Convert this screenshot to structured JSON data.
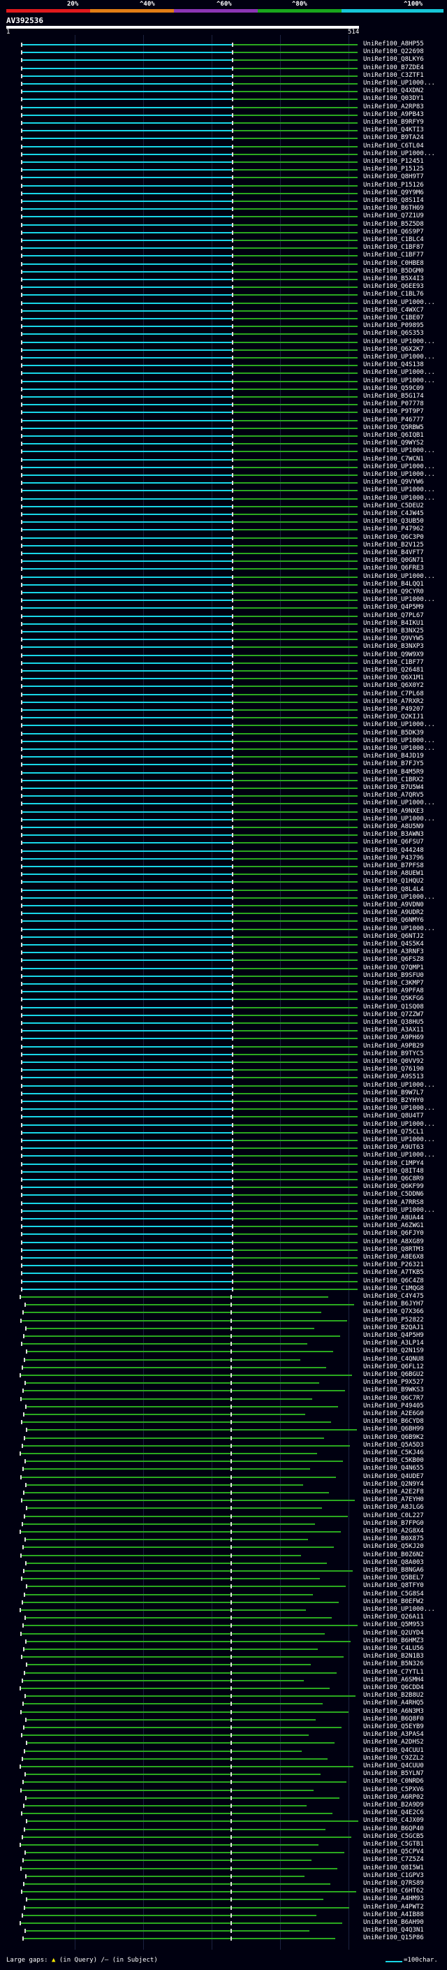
{
  "scale_header": {
    "labels": [
      "20%",
      "^40%",
      "^60%",
      "^80%",
      "^100%"
    ],
    "colors": [
      "#e0191c",
      "#e07c16",
      "#8b35b5",
      "#19a51c",
      "#17c6d8"
    ]
  },
  "query": {
    "name": "AV392536",
    "ruler_start": "1",
    "ruler_end": "514"
  },
  "hits": [
    {
      "label": "UniRef100_A8HP55",
      "coverage_class": "cyan"
    },
    {
      "label": "UniRef100_Q22698",
      "coverage_class": "cyan"
    },
    {
      "label": "UniRef100_Q8LKY6",
      "coverage_class": "cyan"
    },
    {
      "label": "UniRef100_B7ZDE4",
      "coverage_class": "cyan"
    },
    {
      "label": "UniRef100_C3ZTF1",
      "coverage_class": "cyan"
    },
    {
      "label": "UniRef100_UP1000...",
      "coverage_class": "cyan"
    },
    {
      "label": "UniRef100_Q4XDN2",
      "coverage_class": "cyan"
    },
    {
      "label": "UniRef100_Q03DY1",
      "coverage_class": "cyan"
    },
    {
      "label": "UniRef100_A2RP83",
      "coverage_class": "cyan"
    },
    {
      "label": "UniRef100_A9PB43",
      "coverage_class": "cyan"
    },
    {
      "label": "UniRef100_B9RFY9",
      "coverage_class": "cyan"
    },
    {
      "label": "UniRef100_Q4KTI3",
      "coverage_class": "cyan"
    },
    {
      "label": "UniRef100_B9TA24",
      "coverage_class": "cyan"
    },
    {
      "label": "UniRef100_C6TL04",
      "coverage_class": "cyan"
    },
    {
      "label": "UniRef100_UP1000...",
      "coverage_class": "cyan"
    },
    {
      "label": "UniRef100_P12451",
      "coverage_class": "cyan"
    },
    {
      "label": "UniRef100_P15125",
      "coverage_class": "cyan"
    },
    {
      "label": "UniRef100_Q8H9T7",
      "coverage_class": "cyan"
    },
    {
      "label": "UniRef100_P15126",
      "coverage_class": "cyan"
    },
    {
      "label": "UniRef100_Q9Y9M6",
      "coverage_class": "cyan"
    },
    {
      "label": "UniRef100_Q8S1I4",
      "coverage_class": "cyan"
    },
    {
      "label": "UniRef100_B6TH69",
      "coverage_class": "cyan"
    },
    {
      "label": "UniRef100_Q7Z1U9",
      "coverage_class": "cyan"
    },
    {
      "label": "UniRef100_B5Z5D8",
      "coverage_class": "cyan"
    },
    {
      "label": "UniRef100_Q6S9P7",
      "coverage_class": "cyan"
    },
    {
      "label": "UniRef100_C1BLC4",
      "coverage_class": "cyan"
    },
    {
      "label": "UniRef100_C1BF87",
      "coverage_class": "cyan"
    },
    {
      "label": "UniRef100_C1BF77",
      "coverage_class": "cyan"
    },
    {
      "label": "UniRef100_C0HBE8",
      "coverage_class": "cyan"
    },
    {
      "label": "UniRef100_B5DGM0",
      "coverage_class": "cyan"
    },
    {
      "label": "UniRef100_B5X4I3",
      "coverage_class": "cyan"
    },
    {
      "label": "UniRef100_Q6EE93",
      "coverage_class": "cyan"
    },
    {
      "label": "UniRef100_C1BL76",
      "coverage_class": "cyan"
    },
    {
      "label": "UniRef100_UP1000...",
      "coverage_class": "cyan"
    },
    {
      "label": "UniRef100_C4WXC7",
      "coverage_class": "cyan"
    },
    {
      "label": "UniRef100_C1BE07",
      "coverage_class": "cyan"
    },
    {
      "label": "UniRef100_P09895",
      "coverage_class": "cyan"
    },
    {
      "label": "UniRef100_Q6S353",
      "coverage_class": "cyan"
    },
    {
      "label": "UniRef100_UP1000...",
      "coverage_class": "cyan"
    },
    {
      "label": "UniRef100_Q6X2K7",
      "coverage_class": "cyan"
    },
    {
      "label": "UniRef100_UP1000...",
      "coverage_class": "cyan"
    },
    {
      "label": "UniRef100_Q4S138",
      "coverage_class": "cyan"
    },
    {
      "label": "UniRef100_UP1000...",
      "coverage_class": "cyan"
    },
    {
      "label": "UniRef100_UP1000...",
      "coverage_class": "cyan"
    },
    {
      "label": "UniRef100_Q59C09",
      "coverage_class": "cyan"
    },
    {
      "label": "UniRef100_B5G174",
      "coverage_class": "cyan"
    },
    {
      "label": "UniRef100_P07778",
      "coverage_class": "cyan"
    },
    {
      "label": "UniRef100_P9T9P7",
      "coverage_class": "cyan"
    },
    {
      "label": "UniRef100_P46777",
      "coverage_class": "cyan"
    },
    {
      "label": "UniRef100_Q5RBW5",
      "coverage_class": "cyan"
    },
    {
      "label": "UniRef100_Q6IQB1",
      "coverage_class": "cyan"
    },
    {
      "label": "UniRef100_Q9WYS2",
      "coverage_class": "cyan"
    },
    {
      "label": "UniRef100_UP1000...",
      "coverage_class": "cyan"
    },
    {
      "label": "UniRef100_C7WCN1",
      "coverage_class": "cyan"
    },
    {
      "label": "UniRef100_UP1000...",
      "coverage_class": "cyan"
    },
    {
      "label": "UniRef100_UP1000...",
      "coverage_class": "cyan"
    },
    {
      "label": "UniRef100_Q9VYW6",
      "coverage_class": "cyan"
    },
    {
      "label": "UniRef100_UP1000...",
      "coverage_class": "cyan"
    },
    {
      "label": "UniRef100_UP1000...",
      "coverage_class": "cyan"
    },
    {
      "label": "UniRef100_C5DEU2",
      "coverage_class": "cyan"
    },
    {
      "label": "UniRef100_C4JW45",
      "coverage_class": "cyan"
    },
    {
      "label": "UniRef100_Q3UB50",
      "coverage_class": "cyan"
    },
    {
      "label": "UniRef100_P47962",
      "coverage_class": "cyan"
    },
    {
      "label": "UniRef100_Q6C3P0",
      "coverage_class": "cyan"
    },
    {
      "label": "UniRef100_B2V125",
      "coverage_class": "cyan"
    },
    {
      "label": "UniRef100_B4VFT7",
      "coverage_class": "cyan"
    },
    {
      "label": "UniRef100_Q0GN71",
      "coverage_class": "cyan"
    },
    {
      "label": "UniRef100_Q6FRE3",
      "coverage_class": "cyan"
    },
    {
      "label": "UniRef100_UP1000...",
      "coverage_class": "cyan"
    },
    {
      "label": "UniRef100_B4LQQ1",
      "coverage_class": "cyan"
    },
    {
      "label": "UniRef100_Q9CYR0",
      "coverage_class": "cyan"
    },
    {
      "label": "UniRef100_UP1000...",
      "coverage_class": "cyan"
    },
    {
      "label": "UniRef100_Q4P5M9",
      "coverage_class": "cyan"
    },
    {
      "label": "UniRef100_Q7PL67",
      "coverage_class": "cyan"
    },
    {
      "label": "UniRef100_B4IKU1",
      "coverage_class": "cyan"
    },
    {
      "label": "UniRef100_B3NX25",
      "coverage_class": "cyan"
    },
    {
      "label": "UniRef100_Q9VYW5",
      "coverage_class": "cyan"
    },
    {
      "label": "UniRef100_B3NXP3",
      "coverage_class": "cyan"
    },
    {
      "label": "UniRef100_Q9W9X9",
      "coverage_class": "cyan"
    },
    {
      "label": "UniRef100_C1BF77",
      "coverage_class": "cyan"
    },
    {
      "label": "UniRef100_Q26481",
      "coverage_class": "cyan"
    },
    {
      "label": "UniRef100_Q6X1M1",
      "coverage_class": "cyan"
    },
    {
      "label": "UniRef100_Q6X0Y2",
      "coverage_class": "cyan"
    },
    {
      "label": "UniRef100_C7PL68",
      "coverage_class": "cyan"
    },
    {
      "label": "UniRef100_A7RXR2",
      "coverage_class": "cyan"
    },
    {
      "label": "UniRef100_P49207",
      "coverage_class": "cyan"
    },
    {
      "label": "UniRef100_Q2KIJ1",
      "coverage_class": "cyan"
    },
    {
      "label": "UniRef100_UP1000...",
      "coverage_class": "cyan"
    },
    {
      "label": "UniRef100_B5DK39",
      "coverage_class": "cyan"
    },
    {
      "label": "UniRef100_UP1000...",
      "coverage_class": "cyan"
    },
    {
      "label": "UniRef100_UP1000...",
      "coverage_class": "cyan"
    },
    {
      "label": "UniRef100_B4JD19",
      "coverage_class": "cyan"
    },
    {
      "label": "UniRef100_B7FJY5",
      "coverage_class": "cyan"
    },
    {
      "label": "UniRef100_B4M5R9",
      "coverage_class": "cyan"
    },
    {
      "label": "UniRef100_C1BRX2",
      "coverage_class": "cyan"
    },
    {
      "label": "UniRef100_B7U5W4",
      "coverage_class": "cyan"
    },
    {
      "label": "UniRef100_A7QRV5",
      "coverage_class": "cyan"
    },
    {
      "label": "UniRef100_UP1000...",
      "coverage_class": "cyan"
    },
    {
      "label": "UniRef100_A9NXE3",
      "coverage_class": "cyan"
    },
    {
      "label": "UniRef100_UP1000...",
      "coverage_class": "cyan"
    },
    {
      "label": "UniRef100_A8U5N9",
      "coverage_class": "cyan"
    },
    {
      "label": "UniRef100_B3AWN3",
      "coverage_class": "cyan"
    },
    {
      "label": "UniRef100_Q6FSU7",
      "coverage_class": "cyan"
    },
    {
      "label": "UniRef100_Q44248",
      "coverage_class": "cyan"
    },
    {
      "label": "UniRef100_P43796",
      "coverage_class": "cyan"
    },
    {
      "label": "UniRef100_B7PFS8",
      "coverage_class": "cyan"
    },
    {
      "label": "UniRef100_A8UEW1",
      "coverage_class": "cyan"
    },
    {
      "label": "UniRef100_Q1HQU2",
      "coverage_class": "cyan"
    },
    {
      "label": "UniRef100_Q8L4L4",
      "coverage_class": "cyan"
    },
    {
      "label": "UniRef100_UP1000...",
      "coverage_class": "cyan"
    },
    {
      "label": "UniRef100_A9VDN0",
      "coverage_class": "cyan"
    },
    {
      "label": "UniRef100_A9UDR2",
      "coverage_class": "cyan"
    },
    {
      "label": "UniRef100_Q6NMY6",
      "coverage_class": "cyan"
    },
    {
      "label": "UniRef100_UP1000...",
      "coverage_class": "cyan"
    },
    {
      "label": "UniRef100_Q6NTJ2",
      "coverage_class": "cyan"
    },
    {
      "label": "UniRef100_Q4S5K4",
      "coverage_class": "cyan"
    },
    {
      "label": "UniRef100_A3RNF3",
      "coverage_class": "cyan"
    },
    {
      "label": "UniRef100_Q6FSZ8",
      "coverage_class": "cyan"
    },
    {
      "label": "UniRef100_Q7QMP1",
      "coverage_class": "cyan"
    },
    {
      "label": "UniRef100_B9SFU0",
      "coverage_class": "cyan"
    },
    {
      "label": "UniRef100_C3KMP7",
      "coverage_class": "cyan"
    },
    {
      "label": "UniRef100_A9PFA8",
      "coverage_class": "cyan"
    },
    {
      "label": "UniRef100_Q5KFG6",
      "coverage_class": "cyan"
    },
    {
      "label": "UniRef100_Q1SQ08",
      "coverage_class": "cyan"
    },
    {
      "label": "UniRef100_Q7ZZW7",
      "coverage_class": "cyan"
    },
    {
      "label": "UniRef100_Q38HU5",
      "coverage_class": "cyan"
    },
    {
      "label": "UniRef100_A3AX11",
      "coverage_class": "cyan"
    },
    {
      "label": "UniRef100_A9PH69",
      "coverage_class": "cyan"
    },
    {
      "label": "UniRef100_A9PB29",
      "coverage_class": "cyan"
    },
    {
      "label": "UniRef100_B9TYC5",
      "coverage_class": "cyan"
    },
    {
      "label": "UniRef100_Q0VV92",
      "coverage_class": "cyan"
    },
    {
      "label": "UniRef100_Q76190",
      "coverage_class": "cyan"
    },
    {
      "label": "UniRef100_A9S513",
      "coverage_class": "cyan"
    },
    {
      "label": "UniRef100_UP1000...",
      "coverage_class": "cyan"
    },
    {
      "label": "UniRef100_B9W7L7",
      "coverage_class": "cyan"
    },
    {
      "label": "UniRef100_B2YHY0",
      "coverage_class": "cyan"
    },
    {
      "label": "UniRef100_UP1000...",
      "coverage_class": "cyan"
    },
    {
      "label": "UniRef100_Q8U4T7",
      "coverage_class": "cyan"
    },
    {
      "label": "UniRef100_UP1000...",
      "coverage_class": "cyan"
    },
    {
      "label": "UniRef100_Q75CL1",
      "coverage_class": "cyan"
    },
    {
      "label": "UniRef100_UP1000...",
      "coverage_class": "cyan"
    },
    {
      "label": "UniRef100_A9UT63",
      "coverage_class": "cyan"
    },
    {
      "label": "UniRef100_UP1000...",
      "coverage_class": "cyan"
    },
    {
      "label": "UniRef100_C1MPY4",
      "coverage_class": "cyan"
    },
    {
      "label": "UniRef100_Q8IT48",
      "coverage_class": "cyan"
    },
    {
      "label": "UniRef100_Q6C8R9",
      "coverage_class": "cyan"
    },
    {
      "label": "UniRef100_Q6KF99",
      "coverage_class": "cyan"
    },
    {
      "label": "UniRef100_C5DDN6",
      "coverage_class": "cyan"
    },
    {
      "label": "UniRef100_A7RRS8",
      "coverage_class": "cyan"
    },
    {
      "label": "UniRef100_UP1000...",
      "coverage_class": "cyan"
    },
    {
      "label": "UniRef100_A8UA44",
      "coverage_class": "cyan"
    },
    {
      "label": "UniRef100_A6ZWG1",
      "coverage_class": "cyan"
    },
    {
      "label": "UniRef100_Q6FJY0",
      "coverage_class": "cyan"
    },
    {
      "label": "UniRef100_A8XG89",
      "coverage_class": "cyan"
    },
    {
      "label": "UniRef100_Q8RTM3",
      "coverage_class": "cyan"
    },
    {
      "label": "UniRef100_A8E6X8",
      "coverage_class": "cyan"
    },
    {
      "label": "UniRef100_P26321",
      "coverage_class": "cyan"
    },
    {
      "label": "UniRef100_A7TKB5",
      "coverage_class": "cyan"
    },
    {
      "label": "UniRef100_Q6C4Z8",
      "coverage_class": "cyan"
    },
    {
      "label": "UniRef100_C1MQG8",
      "coverage_class": "cyan"
    },
    {
      "label": "UniRef100_C4Y475",
      "coverage_class": "green"
    },
    {
      "label": "UniRef100_B6JYH7",
      "coverage_class": "green"
    },
    {
      "label": "UniRef100_Q7X366",
      "coverage_class": "green"
    },
    {
      "label": "UniRef100_P52822",
      "coverage_class": "green"
    },
    {
      "label": "UniRef100_B2QAJ1",
      "coverage_class": "green"
    },
    {
      "label": "UniRef100_Q4P5H9",
      "coverage_class": "green"
    },
    {
      "label": "UniRef100_A3LP14",
      "coverage_class": "green"
    },
    {
      "label": "UniRef100_Q2N1S9",
      "coverage_class": "green"
    },
    {
      "label": "UniRef100_C4QNU8",
      "coverage_class": "green"
    },
    {
      "label": "UniRef100_Q6FL12",
      "coverage_class": "green"
    },
    {
      "label": "UniRef100_Q6BGU2",
      "coverage_class": "green"
    },
    {
      "label": "UniRef100_P9X527",
      "coverage_class": "green"
    },
    {
      "label": "UniRef100_B9WKS3",
      "coverage_class": "green"
    },
    {
      "label": "UniRef100_Q6C7R7",
      "coverage_class": "green"
    },
    {
      "label": "UniRef100_P49405",
      "coverage_class": "green"
    },
    {
      "label": "UniRef100_A2E6G0",
      "coverage_class": "green"
    },
    {
      "label": "UniRef100_B6CYD8",
      "coverage_class": "green"
    },
    {
      "label": "UniRef100_Q6BH99",
      "coverage_class": "green"
    },
    {
      "label": "UniRef100_Q6B9K2",
      "coverage_class": "green"
    },
    {
      "label": "UniRef100_Q5A5D3",
      "coverage_class": "green"
    },
    {
      "label": "UniRef100_C5KJ46",
      "coverage_class": "green"
    },
    {
      "label": "UniRef100_C5KB00",
      "coverage_class": "green"
    },
    {
      "label": "UniRef100_Q4N655",
      "coverage_class": "green"
    },
    {
      "label": "UniRef100_Q4UDE7",
      "coverage_class": "green"
    },
    {
      "label": "UniRef100_Q2N9Y4",
      "coverage_class": "green"
    },
    {
      "label": "UniRef100_A2E2F8",
      "coverage_class": "green"
    },
    {
      "label": "UniRef100_A7EYH0",
      "coverage_class": "green"
    },
    {
      "label": "UniRef100_A8JLG6",
      "coverage_class": "green"
    },
    {
      "label": "UniRef100_C0L227",
      "coverage_class": "green"
    },
    {
      "label": "UniRef100_B7FPG0",
      "coverage_class": "green"
    },
    {
      "label": "UniRef100_A2G8X4",
      "coverage_class": "green"
    },
    {
      "label": "UniRef100_B0X875",
      "coverage_class": "green"
    },
    {
      "label": "UniRef100_Q5KJ20",
      "coverage_class": "green"
    },
    {
      "label": "UniRef100_B0Z6N2",
      "coverage_class": "green"
    },
    {
      "label": "UniRef100_Q8A003",
      "coverage_class": "green"
    },
    {
      "label": "UniRef100_B8NGA6",
      "coverage_class": "green"
    },
    {
      "label": "UniRef100_Q5BEL7",
      "coverage_class": "green"
    },
    {
      "label": "UniRef100_Q8TFY0",
      "coverage_class": "green"
    },
    {
      "label": "UniRef100_C5G8S4",
      "coverage_class": "green"
    },
    {
      "label": "UniRef100_B0EFW2",
      "coverage_class": "green"
    },
    {
      "label": "UniRef100_UP1000...",
      "coverage_class": "green"
    },
    {
      "label": "UniRef100_Q26A11",
      "coverage_class": "green"
    },
    {
      "label": "UniRef100_Q5M953",
      "coverage_class": "green"
    },
    {
      "label": "UniRef100_Q2UYD4",
      "coverage_class": "green"
    },
    {
      "label": "UniRef100_B6HMZ3",
      "coverage_class": "green"
    },
    {
      "label": "UniRef100_C4LU56",
      "coverage_class": "green"
    },
    {
      "label": "UniRef100_B2N1B3",
      "coverage_class": "green"
    },
    {
      "label": "UniRef100_B5N326",
      "coverage_class": "green"
    },
    {
      "label": "UniRef100_C7YTL1",
      "coverage_class": "green"
    },
    {
      "label": "UniRef100_A6SMH4",
      "coverage_class": "green"
    },
    {
      "label": "UniRef100_Q6CDD4",
      "coverage_class": "green"
    },
    {
      "label": "UniRef100_B2B8U2",
      "coverage_class": "green"
    },
    {
      "label": "UniRef100_A4RHQ5",
      "coverage_class": "green"
    },
    {
      "label": "UniRef100_A6N3M3",
      "coverage_class": "green"
    },
    {
      "label": "UniRef100_B6Q8F0",
      "coverage_class": "green"
    },
    {
      "label": "UniRef100_Q5EYB9",
      "coverage_class": "green"
    },
    {
      "label": "UniRef100_A3PAS4",
      "coverage_class": "green"
    },
    {
      "label": "UniRef100_A2DHS2",
      "coverage_class": "green"
    },
    {
      "label": "UniRef100_Q4CUU1",
      "coverage_class": "green"
    },
    {
      "label": "UniRef100_C9ZZL2",
      "coverage_class": "green"
    },
    {
      "label": "UniRef100_Q4CUU0",
      "coverage_class": "green"
    },
    {
      "label": "UniRef100_B5YLN7",
      "coverage_class": "green"
    },
    {
      "label": "UniRef100_C0NRD6",
      "coverage_class": "green"
    },
    {
      "label": "UniRef100_C5PXV6",
      "coverage_class": "green"
    },
    {
      "label": "UniRef100_A6RP02",
      "coverage_class": "green"
    },
    {
      "label": "UniRef100_B2A9D9",
      "coverage_class": "green"
    },
    {
      "label": "UniRef100_Q4E2C6",
      "coverage_class": "green"
    },
    {
      "label": "UniRef100_C4JX09",
      "coverage_class": "green"
    },
    {
      "label": "UniRef100_B6QP40",
      "coverage_class": "green"
    },
    {
      "label": "UniRef100_C5GCB5",
      "coverage_class": "green"
    },
    {
      "label": "UniRef100_C5GTB1",
      "coverage_class": "green"
    },
    {
      "label": "UniRef100_Q5CPV4",
      "coverage_class": "green"
    },
    {
      "label": "UniRef100_C7Z5Z4",
      "coverage_class": "green"
    },
    {
      "label": "UniRef100_Q8I5W1",
      "coverage_class": "green"
    },
    {
      "label": "UniRef100_C1GPV3",
      "coverage_class": "green"
    },
    {
      "label": "UniRef100_Q7RS89",
      "coverage_class": "green"
    },
    {
      "label": "UniRef100_C6HT62",
      "coverage_class": "green"
    },
    {
      "label": "UniRef100_A4HM93",
      "coverage_class": "green"
    },
    {
      "label": "UniRef100_A4PWT2",
      "coverage_class": "green"
    },
    {
      "label": "UniRef100_A4IB88",
      "coverage_class": "green"
    },
    {
      "label": "UniRef100_B6AH90",
      "coverage_class": "green"
    },
    {
      "label": "UniRef100_Q4Q3N1",
      "coverage_class": "green"
    },
    {
      "label": "UniRef100_Q15P86",
      "coverage_class": "green"
    }
  ],
  "footer": {
    "gaps_label": "Large gaps:",
    "gap_query_mark": "▲",
    "gaps_query_text": "(in Query)",
    "gaps_subject_text": "/– (in Subject)",
    "scale_text": "=100char."
  }
}
